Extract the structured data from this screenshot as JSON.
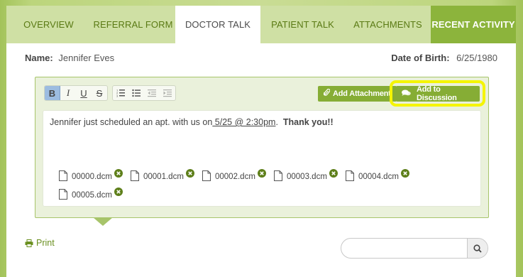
{
  "tabs": [
    {
      "label": "OVERVIEW"
    },
    {
      "label": "REFERRAL FORM"
    },
    {
      "label": "DOCTOR TALK"
    },
    {
      "label": "PATIENT TALK"
    },
    {
      "label": "ATTACHMENTS"
    },
    {
      "label": "RECENT ACTIVITY"
    }
  ],
  "active_tab": "DOCTOR TALK",
  "patient": {
    "name_label": "Name:",
    "name": "Jennifer Eves",
    "dob_label": "Date of Birth:",
    "dob": "6/25/1980"
  },
  "toolbar": {
    "bold": "B",
    "italic": "I",
    "underline": "U",
    "strike": "S",
    "add_attachment": "Add Attachment",
    "add_to_discussion": "Add to Discussion"
  },
  "message": {
    "text_before": "Jennifer just scheduled an apt. with us on",
    "link": " 5/25 @ 2:30pm",
    "text_after": ".  ",
    "bold": "Thank you!!"
  },
  "attachments": [
    {
      "name": "00000.dcm"
    },
    {
      "name": "00001.dcm"
    },
    {
      "name": "00002.dcm"
    },
    {
      "name": "00003.dcm"
    },
    {
      "name": "00004.dcm"
    },
    {
      "name": "00005.dcm"
    }
  ],
  "footer": {
    "print_label": "Print",
    "search_placeholder": ""
  },
  "colors": {
    "brand_green": "#86ad35",
    "tab_bar": "#cfe0a4",
    "highlight": "#f5f500"
  }
}
